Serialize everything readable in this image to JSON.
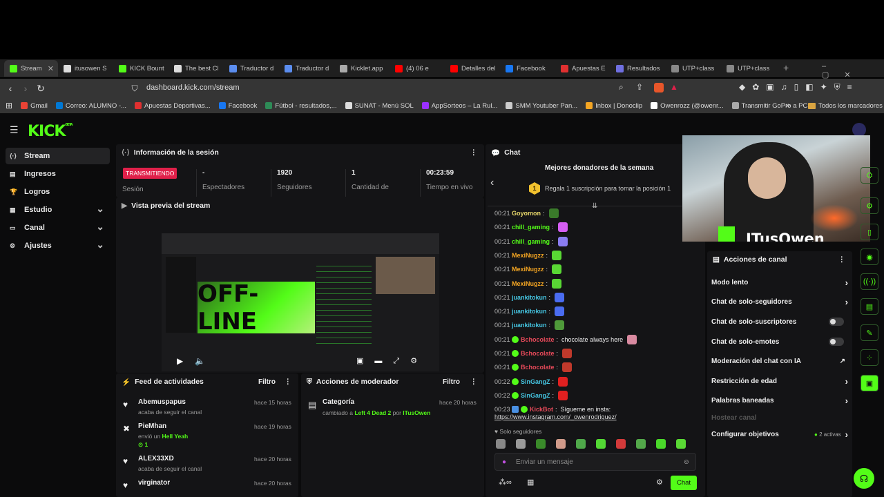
{
  "tabs": [
    {
      "label": "Stream",
      "fav": "#53fc18",
      "active": true
    },
    {
      "label": "itusowen S",
      "fav": "#dddddd"
    },
    {
      "label": "KICK Bount",
      "fav": "#53fc18"
    },
    {
      "label": "The best Cl",
      "fav": "#dddddd"
    },
    {
      "label": "Traductor d",
      "fav": "#5b8def"
    },
    {
      "label": "Traductor d",
      "fav": "#5b8def"
    },
    {
      "label": "Kicklet.app",
      "fav": "#aaaaaa"
    },
    {
      "label": "(4) 06 e",
      "fav": "#ff0000"
    },
    {
      "label": "Detalles del",
      "fav": "#ff0000"
    },
    {
      "label": "Facebook",
      "fav": "#1877f2"
    },
    {
      "label": "Apuestas E",
      "fav": "#e03030"
    },
    {
      "label": "Resultados",
      "fav": "#6f6fe0"
    },
    {
      "label": "UTP+class",
      "fav": "#888888"
    },
    {
      "label": "UTP+class",
      "fav": "#888888"
    }
  ],
  "url": "dashboard.kick.com/stream",
  "bookmarks": [
    {
      "label": "Gmail",
      "c": "#ea4335"
    },
    {
      "label": "Correo: ALUMNO -...",
      "c": "#0078d4"
    },
    {
      "label": "Apuestas Deportivas...",
      "c": "#e03030"
    },
    {
      "label": "Facebook",
      "c": "#1877f2"
    },
    {
      "label": "Fútbol - resultados,...",
      "c": "#2e8b57"
    },
    {
      "label": "SUNAT - Menú SOL",
      "c": "#dddddd"
    },
    {
      "label": "AppSorteos – La Rul...",
      "c": "#9b30ff"
    },
    {
      "label": "SMM Youtuber Pan...",
      "c": "#cccccc"
    },
    {
      "label": "Inbox | Donoclip",
      "c": "#f5a623"
    },
    {
      "label": "Owenrozz (@owenr...",
      "c": "#ffffff"
    },
    {
      "label": "Transmitir GoPro a PC",
      "c": "#aaaaaa"
    }
  ],
  "bookmarks_all": "Todos los marcadores",
  "sidebar": [
    {
      "label": "Stream",
      "icon": "⟨·⟩",
      "active": true,
      "chev": false
    },
    {
      "label": "Ingresos",
      "icon": "▤",
      "chev": false
    },
    {
      "label": "Logros",
      "icon": "🏆",
      "chev": false
    },
    {
      "label": "Estudio",
      "icon": "▦",
      "chev": true
    },
    {
      "label": "Canal",
      "icon": "▭",
      "chev": true
    },
    {
      "label": "Ajustes",
      "icon": "⚙",
      "chev": true
    }
  ],
  "session": {
    "title": "Información de la sesión",
    "live": "TRANSMITIENDO",
    "live_label": "Sesión",
    "stats": [
      {
        "value": "-",
        "label": "Espectadores"
      },
      {
        "value": "1920",
        "label": "Seguidores"
      },
      {
        "value": "1",
        "label": "Cantidad de"
      },
      {
        "value": "00:23:59",
        "label": "Tiempo en vivo"
      }
    ]
  },
  "preview": {
    "title": "Vista previa del stream",
    "overlay_text": "OFF-LINE",
    "streamer": "ITusOwen"
  },
  "feed": {
    "title": "Feed de actividades",
    "filter": "Filtro",
    "items": [
      {
        "name": "Abemuspapus",
        "sub": "acaba de seguir el canal",
        "time": "hace 15 horas",
        "icon": "♥"
      },
      {
        "name": "PieMhan",
        "sub": "envió un",
        "extra": "Hell Yeah",
        "count": "1",
        "time": "hace 19 horas",
        "icon": "✖"
      },
      {
        "name": "ALEX33XD",
        "sub": "acaba de seguir el canal",
        "time": "hace 20 horas",
        "icon": "♥"
      },
      {
        "name": "virginator",
        "sub": "",
        "time": "hace 20 horas",
        "icon": "♥"
      }
    ]
  },
  "modactions": {
    "title": "Acciones de moderador",
    "filter": "Filtro",
    "item": {
      "name": "Categoría",
      "pre": "cambiado a",
      "game": "Left 4 Dead 2",
      "by": "por",
      "user": "ITusOwen",
      "time": "hace 20 horas"
    }
  },
  "chat": {
    "title": "Chat",
    "donors_title": "Mejores donadores de la semana",
    "donors_cta": "Regala 1 suscripción para tomar la posición 1",
    "donors_rank": "1",
    "messages": [
      {
        "t": "00:21",
        "user": "Goyomon",
        "color": "#e8d86b",
        "badge": false,
        "text": "",
        "emote": "#3a7a2a"
      },
      {
        "t": "00:21",
        "user": "chill_gaming",
        "color": "#53fc18",
        "badge": false,
        "text": "",
        "emote": "#d55df2"
      },
      {
        "t": "00:21",
        "user": "chill_gaming",
        "color": "#53fc18",
        "badge": false,
        "text": "",
        "emote": "#8a7cf0"
      },
      {
        "t": "00:21",
        "user": "MexiNugzz",
        "color": "#f5a623",
        "badge": false,
        "text": "",
        "emote": "#59d834"
      },
      {
        "t": "00:21",
        "user": "MexiNugzz",
        "color": "#f5a623",
        "badge": false,
        "text": "",
        "emote": "#59d834"
      },
      {
        "t": "00:21",
        "user": "MexiNugzz",
        "color": "#f5a623",
        "badge": false,
        "text": "",
        "emote": "#59d834"
      },
      {
        "t": "00:21",
        "user": "juankitokun",
        "color": "#45c4e0",
        "badge": false,
        "text": "",
        "emote": "#4a6cf0"
      },
      {
        "t": "00:21",
        "user": "juankitokun",
        "color": "#45c4e0",
        "badge": false,
        "text": "",
        "emote": "#4a6cf0"
      },
      {
        "t": "00:21",
        "user": "juankitokun",
        "color": "#45c4e0",
        "badge": false,
        "text": "",
        "emote": "#4f9a3a"
      },
      {
        "t": "00:21",
        "user": "Bchocolate",
        "color": "#e84a5a",
        "badge": true,
        "text": "chocolate always here",
        "emote": "#d98aa0"
      },
      {
        "t": "00:21",
        "user": "Bchocolate",
        "color": "#e84a5a",
        "badge": true,
        "text": "",
        "emote": "#c0392b"
      },
      {
        "t": "00:21",
        "user": "Bchocolate",
        "color": "#e84a5a",
        "badge": true,
        "text": "",
        "emote": "#c0392b"
      },
      {
        "t": "00:22",
        "user": "SinGangZ",
        "color": "#45c4e0",
        "badge": true,
        "text": "",
        "emote": "#e02020"
      },
      {
        "t": "00:22",
        "user": "SinGangZ",
        "color": "#45c4e0",
        "badge": true,
        "text": "",
        "emote": "#e02020"
      },
      {
        "t": "00:23",
        "user": "KickBot",
        "color": "#e84a5a",
        "badge": true,
        "text": "Sígueme en insta:",
        "emote": ""
      }
    ],
    "link": "https://www.instagram.com/_owenrodriguez/",
    "followers_only": "Solo seguidores",
    "placeholder": "Enviar un mensaje",
    "send": "Chat"
  },
  "actions": {
    "title": "Acciones de canal",
    "items": [
      {
        "label": "Modo lento",
        "ctrl": "chev"
      },
      {
        "label": "Chat de solo-seguidores",
        "ctrl": "chev"
      },
      {
        "label": "Chat de solo-suscriptores",
        "ctrl": "toggle"
      },
      {
        "label": "Chat de solo-emotes",
        "ctrl": "toggle"
      },
      {
        "label": "Moderación del chat con IA",
        "ctrl": "ext"
      },
      {
        "label": "Restricción de edad",
        "ctrl": "chev"
      },
      {
        "label": "Palabras baneadas",
        "ctrl": "chev"
      },
      {
        "label": "Hostear canal",
        "ctrl": "none",
        "disabled": true
      },
      {
        "label": "Configurar objetivos",
        "ctrl": "chev",
        "note": "2 activas"
      }
    ]
  },
  "webcam": {
    "name": "ITusOwen"
  },
  "colors": {
    "accent": "#53fc18",
    "live": "#e0204a",
    "panel": "#141416"
  }
}
